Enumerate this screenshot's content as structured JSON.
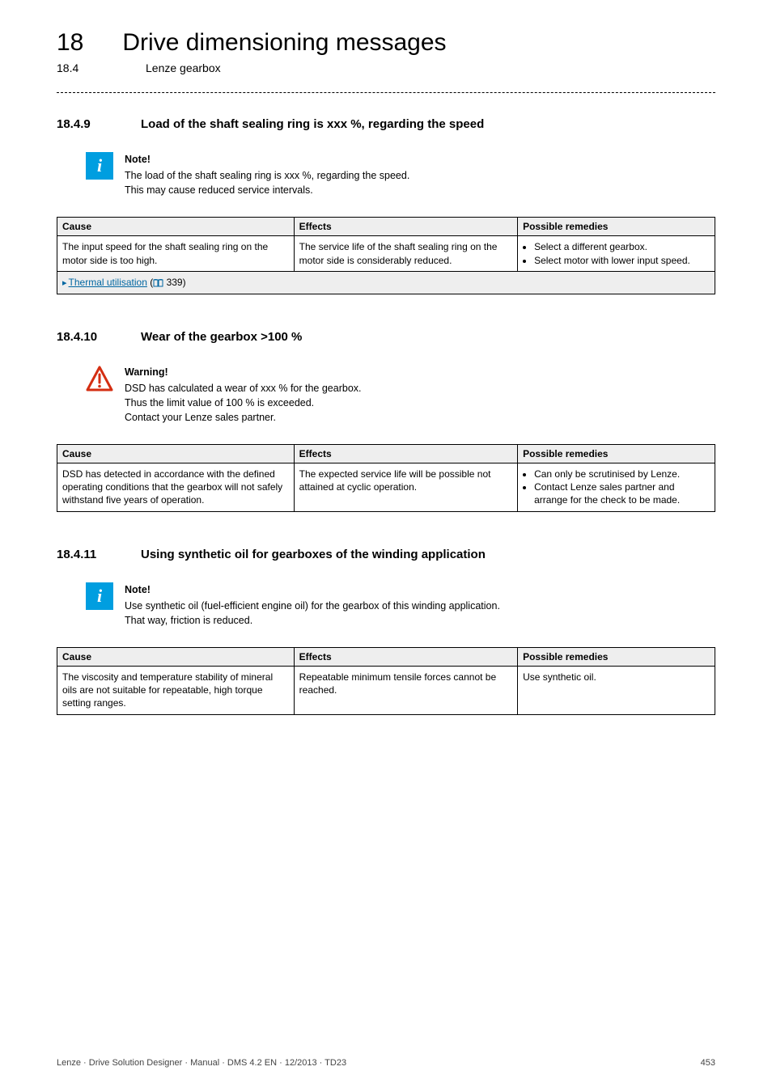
{
  "header": {
    "chapter_num": "18",
    "chapter_title": "Drive dimensioning messages",
    "sub_num": "18.4",
    "sub_title": "Lenze gearbox"
  },
  "section1": {
    "num": "18.4.9",
    "title": "Load of the shaft sealing ring is xxx %, regarding the speed",
    "note_label": "Note!",
    "note_line1": "The load of the shaft sealing ring is xxx %, regarding the speed.",
    "note_line2": "This may cause reduced service intervals.",
    "th1": "Cause",
    "th2": "Effects",
    "th3": "Possible remedies",
    "cause": "The input speed for the shaft sealing ring on the motor side is too high.",
    "effects": "The service life of the shaft sealing ring on the motor side is considerably reduced.",
    "rem1": "Select a different gearbox.",
    "rem2": "Select motor with lower input speed.",
    "link_text": "Thermal utilisation",
    "link_page_open": "(",
    "link_page_num": " 339)",
    "icon_glyph": "i"
  },
  "section2": {
    "num": "18.4.10",
    "title": "Wear of the gearbox >100 %",
    "warn_label": "Warning!",
    "warn_line1": "DSD has calculated a wear of xxx % for the gearbox.",
    "warn_line2": "Thus the limit value of 100 % is exceeded.",
    "warn_line3": "Contact your Lenze sales partner.",
    "th1": "Cause",
    "th2": "Effects",
    "th3": "Possible remedies",
    "cause": "DSD has detected in accordance with the defined operating conditions that the gearbox will not safely withstand five years of operation.",
    "effects": "The expected service life will be possible not attained at cyclic operation.",
    "rem1": "Can only be scrutinised by Lenze.",
    "rem2": "Contact Lenze sales partner and arrange for the check to be made."
  },
  "section3": {
    "num": "18.4.11",
    "title": "Using synthetic oil for gearboxes of the winding application",
    "note_label": "Note!",
    "note_line1": "Use synthetic oil (fuel-efficient engine oil) for the gearbox of this winding application.",
    "note_line2": "That way, friction is reduced.",
    "th1": "Cause",
    "th2": "Effects",
    "th3": "Possible remedies",
    "cause": "The viscosity and temperature stability of mineral oils are not suitable for repeatable, high torque setting ranges.",
    "effects": "Repeatable minimum tensile forces cannot be reached.",
    "remedy": "Use synthetic oil.",
    "icon_glyph": "i"
  },
  "footer": {
    "left": "Lenze · Drive Solution Designer · Manual · DMS 4.2 EN · 12/2013 · TD23",
    "right": "453"
  }
}
